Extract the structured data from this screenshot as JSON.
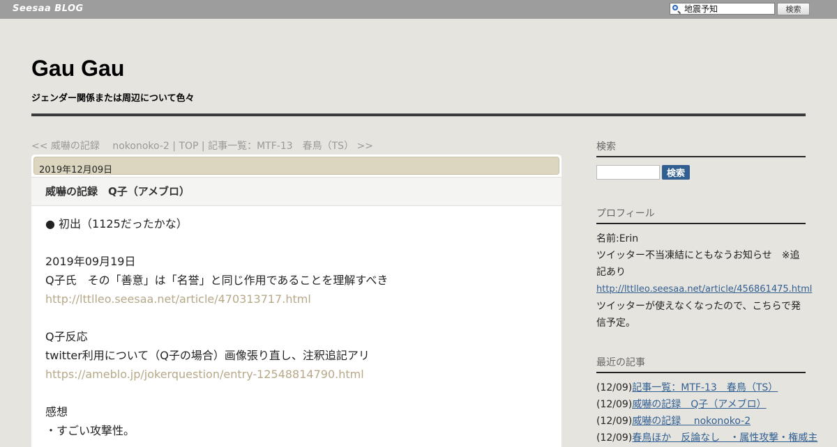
{
  "topbar": {
    "brand_word1": "Seesaa",
    "brand_word2": "BLOG",
    "search_value": "地震予知",
    "search_button": "検索"
  },
  "header": {
    "title": "Gau Gau",
    "description": "ジェンダー関係または周辺について色々"
  },
  "nav": {
    "prev": "<< 威嚇の記録　 nokonoko-2",
    "sep1": " | ",
    "top": "TOP",
    "sep2": " | ",
    "next": "記事一覧：MTF-13　春鳥（TS） >>"
  },
  "article": {
    "date": "2019年12月09日",
    "title": "威嚇の記録　Q子（アメブロ）",
    "lines": [
      {
        "text": "● 初出（1125だったかな）",
        "link": false
      },
      {
        "text": "",
        "link": false
      },
      {
        "text": "2019年09月19日",
        "link": false
      },
      {
        "text": "Q子氏　その「善意」は「名誉」と同じ作用であることを理解すべき",
        "link": false
      },
      {
        "text": "http://lttlleo.seesaa.net/article/470313717.html",
        "link": true
      },
      {
        "text": "",
        "link": false
      },
      {
        "text": "Q子反応",
        "link": false
      },
      {
        "text": "twitter利用について（Q子の場合）画像張り直し、注釈追記アリ",
        "link": false
      },
      {
        "text": "https://ameblo.jp/jokerquestion/entry-12548814790.html",
        "link": true
      },
      {
        "text": "",
        "link": false
      },
      {
        "text": "感想",
        "link": false
      },
      {
        "text": "・すごい攻撃性。",
        "link": false
      }
    ]
  },
  "sidebar": {
    "search_heading": "検索",
    "search_button": "検索",
    "profile_heading": "プロフィール",
    "profile_name": "名前:Erin",
    "profile_notice_1": "ツイッター不当凍結にともなうお知らせ　※追",
    "profile_notice_2": "記あり",
    "profile_link": "http://lttlleo.seesaa.net/article/456861475.html",
    "profile_text_1": "ツイッターが使えなくなったので、こちらで発",
    "profile_text_2": "信予定。",
    "recent_heading": "最近の記事",
    "recent": [
      {
        "date": "(12/09)",
        "title": "記事一覧：MTF-13　春鳥（TS）"
      },
      {
        "date": "(12/09)",
        "title": "威嚇の記録　Q子（アメブロ）"
      },
      {
        "date": "(12/09)",
        "title": "威嚇の記録　 nokonoko-2"
      },
      {
        "date": "(12/09)",
        "title": "春鳥ほか　反論なし　・属性攻撃・権威主"
      }
    ]
  }
}
